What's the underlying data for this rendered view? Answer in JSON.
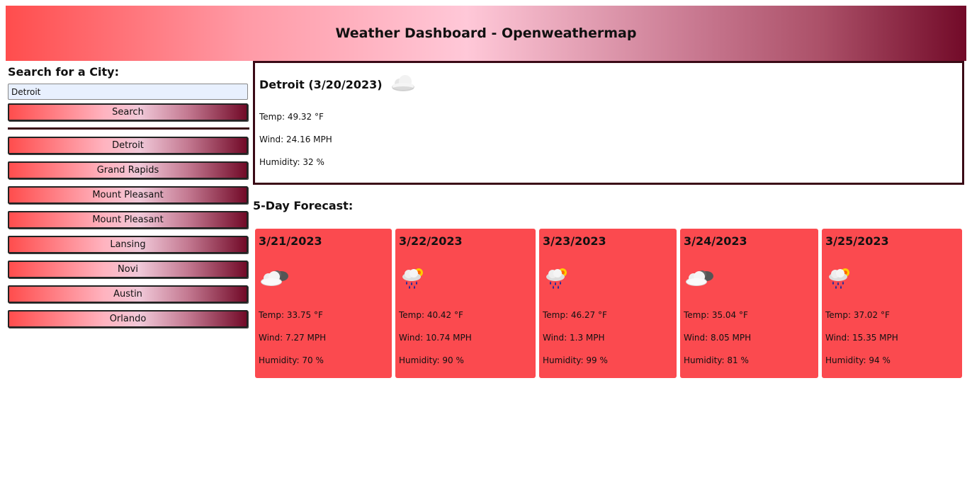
{
  "header": {
    "title": "Weather Dashboard - Openweathermap"
  },
  "search": {
    "label": "Search for a City:",
    "value": "Detroit",
    "button_label": "Search"
  },
  "history": [
    "Detroit",
    "Grand Rapids",
    "Mount Pleasant",
    "Mount Pleasant",
    "Lansing",
    "Novi",
    "Austin",
    "Orlando"
  ],
  "current": {
    "title": "Detroit (3/20/2023)",
    "icon": "cloud-icon",
    "temp": "Temp: 49.32 °F",
    "wind": "Wind: 24.16 MPH",
    "humidity": "Humidity: 32 %"
  },
  "forecast": {
    "label": "5-Day Forecast:",
    "days": [
      {
        "date": "3/21/2023",
        "icon": "partly-cloudy-icon",
        "temp": "Temp: 33.75 °F",
        "wind": "Wind: 7.27 MPH",
        "humidity": "Humidity: 70 %"
      },
      {
        "date": "3/22/2023",
        "icon": "rain-sun-icon",
        "temp": "Temp: 40.42 °F",
        "wind": "Wind: 10.74 MPH",
        "humidity": "Humidity: 90 %"
      },
      {
        "date": "3/23/2023",
        "icon": "rain-sun-icon",
        "temp": "Temp: 46.27 °F",
        "wind": "Wind: 1.3 MPH",
        "humidity": "Humidity: 99 %"
      },
      {
        "date": "3/24/2023",
        "icon": "partly-cloudy-icon",
        "temp": "Temp: 35.04 °F",
        "wind": "Wind: 8.05 MPH",
        "humidity": "Humidity: 81 %"
      },
      {
        "date": "3/25/2023",
        "icon": "rain-sun-icon",
        "temp": "Temp: 37.02 °F",
        "wind": "Wind: 15.35 MPH",
        "humidity": "Humidity: 94 %"
      }
    ]
  },
  "colors": {
    "accent": "#fb4a4f",
    "dark": "#3a0a16",
    "gradient_end": "#720a28"
  }
}
